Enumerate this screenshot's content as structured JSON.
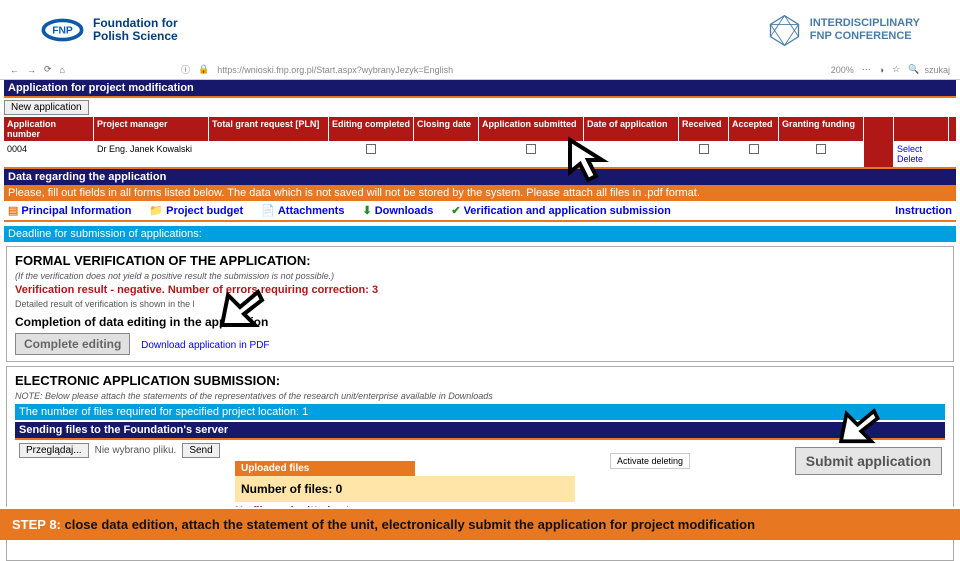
{
  "header": {
    "fnp_line1": "Foundation for",
    "fnp_line2": "Polish Science",
    "conf_line1": "INTERDISCIPLINARY",
    "conf_line2": "FNP CONFERENCE"
  },
  "browser": {
    "url": "https://wnioski.fnp.org.pl/Start.aspx?wybranyJezyk=English",
    "zoom": "200%",
    "search_placeholder": "szukaj"
  },
  "titlebar": "Application for project modification",
  "new_app": "New application",
  "cols": {
    "c1": "Application number",
    "c2": "Project manager",
    "c3": "Total grant request [PLN]",
    "c4": "Editing completed",
    "c5": "Closing date",
    "c6": "Application submitted",
    "c7": "Date of application",
    "c8": "Received",
    "c9": "Accepted",
    "c10": "Granting funding"
  },
  "row": {
    "num": "0004",
    "mgr": "Dr Eng. Janek Kowalski",
    "select": "Select",
    "delete": "Delete"
  },
  "data_regarding": "Data regarding the application",
  "warning": "Please, fill out fields in all forms listed below. The data which is not saved will not be stored by the system. Please attach all files in .pdf format.",
  "tabs": {
    "pi": "Principal Information",
    "pb": "Project budget",
    "att": "Attachments",
    "dl": "Downloads",
    "vs": "Verification and application submission",
    "instr": "Instruction"
  },
  "deadline": "Deadline for submission of applications:",
  "formal": {
    "title": "FORMAL VERIFICATION OF THE APPLICATION:",
    "note": "(If the verification does not yield a positive result the submission is not possible.)",
    "neg": "Verification result - negative. Number of errors requiring correction: 3",
    "detail": "Detailed result of verification is shown in the l",
    "compl": "Completion of data editing in the application",
    "btn": "Complete editing",
    "pdf": "Download application in PDF"
  },
  "electronic": {
    "title": "ELECTRONIC APPLICATION SUBMISSION:",
    "note": "NOTE: Below please attach the statements of the representatives of the research unit/enterprise available in Downloads",
    "files_req": "The number of files required for specified project location: 1",
    "sending": "Sending files to the Foundation's server",
    "browse": "Przeglądaj...",
    "nofile": "Nie wybrano pliku.",
    "send": "Send",
    "uploaded": "Uploaded files",
    "numfiles": "Number of files: 0",
    "nosub": "No files submitted yet",
    "activate": "Activate deleting",
    "submit": "Submit application"
  },
  "footer": {
    "step": "STEP 8:",
    "text": " close data edition, attach the statement of the unit, electronically submit the application for project modification"
  }
}
